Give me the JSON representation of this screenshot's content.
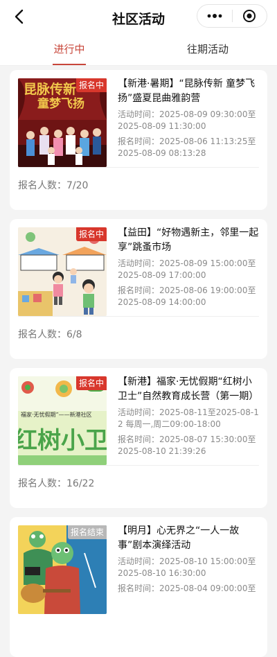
{
  "header": {
    "title": "社区活动",
    "back_icon": "back-arrow-icon",
    "more_icon": "more-dots-icon",
    "close_icon": "mini-program-close-icon"
  },
  "tabs": [
    {
      "label": "进行中",
      "active": true
    },
    {
      "label": "往期活动",
      "active": false
    }
  ],
  "activities": [
    {
      "badge": "报名中",
      "title": "【新港·暑期】“昆脉传新 童梦飞扬”盛夏昆曲雅韵营",
      "activity_time": "活动时间：2025-08-09 09:30:00至2025-08-09 11:30:00",
      "signup_time": "报名时间：2025-08-06 11:13:25至2025-08-09 08:13:28",
      "count": "报名人数：7/20",
      "image_text": "昆脉传新 童梦飞扬"
    },
    {
      "badge": "报名中",
      "title": "【益田】“好物遇新主，邻里一起享”跳蚤市场",
      "activity_time": "活动时间：2025-08-09 15:00:00至2025-08-09 17:00:00",
      "signup_time": "报名时间：2025-08-06 19:00:00至2025-08-09 14:00:00",
      "count": "报名人数：6/8",
      "image_text": ""
    },
    {
      "badge": "报名中",
      "title": "【新港】福家·无忧假期“红树小卫士”自然教育成长营（第一期）",
      "activity_time": "活动时间：2025-08-11至2025-08-12 每周一,周二09:00-18:00",
      "signup_time": "报名时间：2025-08-07 15:30:00至2025-08-10 21:39:26",
      "count": "报名人数：16/22",
      "image_text": "红树小卫士",
      "image_subtext": "福家·无忧假期”——新港社区"
    },
    {
      "badge": "报名结束",
      "title": "【明月】心无界之“一人一故事”剧本演绎活动",
      "activity_time": "活动时间：2025-08-10 15:00:00至2025-08-10 16:30:00",
      "signup_time": "报名时间：2025-08-04 09:00:00至",
      "count": "",
      "image_text": ""
    }
  ],
  "colors": {
    "accent": "#c8463a",
    "badge_active": "#d8372c",
    "badge_ended": "#b8b8b8",
    "background": "#f4f4f4"
  }
}
